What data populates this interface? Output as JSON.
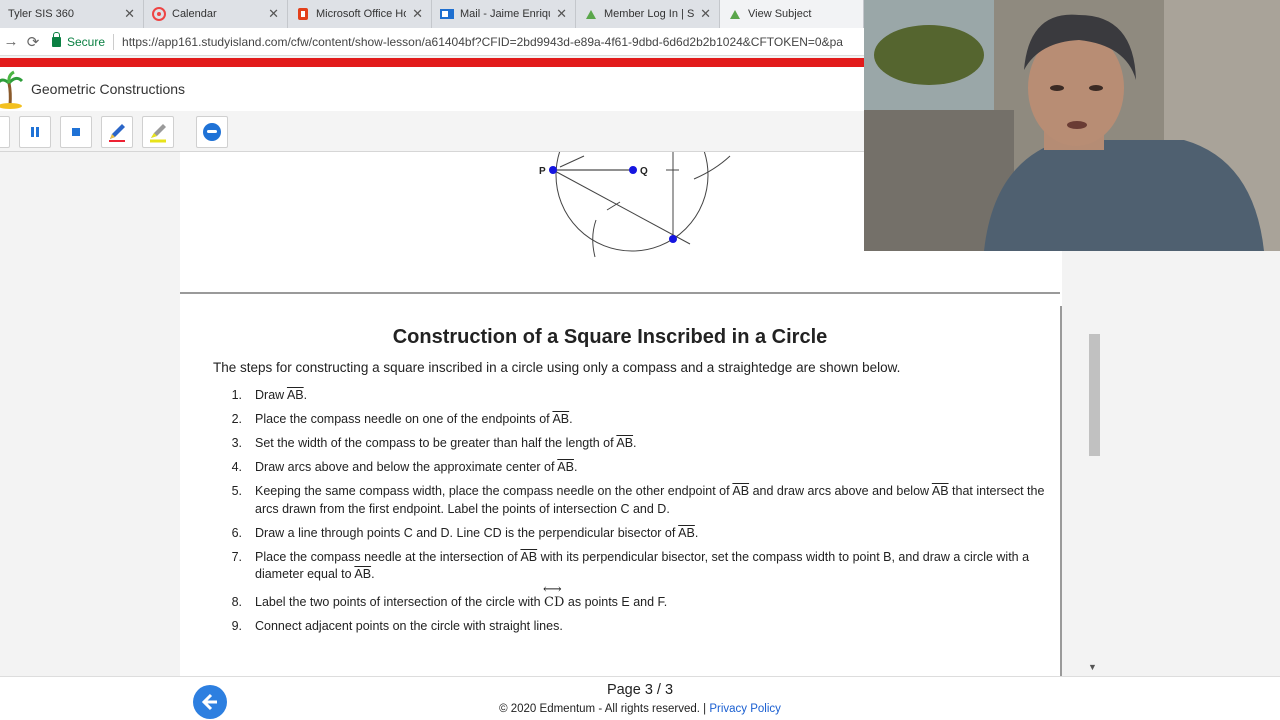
{
  "browser": {
    "tabs": [
      {
        "label": "Tyler SIS 360",
        "icon": "page-icon"
      },
      {
        "label": "Calendar",
        "icon": "calendar-icon"
      },
      {
        "label": "Microsoft Office Home",
        "icon": "office-icon"
      },
      {
        "label": "Mail - Jaime Enriquez",
        "icon": "mail-icon"
      },
      {
        "label": "Member Log In | Study",
        "icon": "study-island-icon"
      },
      {
        "label": "View Subject",
        "icon": "study-island-icon"
      }
    ],
    "secure_label": "Secure",
    "url": "https://app161.studyisland.com/cfw/content/show-lesson/a61404bf?CFID=2bd9943d-e89a-4f61-9dbd-6d6d2b2b1024&CFTOKEN=0&pa"
  },
  "app": {
    "title": "Geometric Constructions"
  },
  "diagram": {
    "point_p": "P",
    "point_q": "Q"
  },
  "lesson": {
    "title": "Construction of a Square Inscribed in a Circle",
    "intro": "The steps for constructing a square inscribed in a circle using only a compass and a straightedge are shown below.",
    "steps": [
      {
        "num": "1.",
        "parts": [
          "Draw ",
          "AB",
          "."
        ]
      },
      {
        "num": "2.",
        "parts": [
          "Place the compass needle on one of the endpoints of ",
          "AB",
          "."
        ]
      },
      {
        "num": "3.",
        "parts": [
          "Set the width of the compass to be greater than half the length of ",
          "AB",
          "."
        ]
      },
      {
        "num": "4.",
        "parts": [
          "Draw arcs above and below the approximate center of ",
          "AB",
          "."
        ]
      },
      {
        "num": "5.",
        "parts": [
          "Keeping the same compass width, place the compass needle on the other endpoint of ",
          "AB",
          " and draw arcs above and below ",
          "AB",
          " that intersect the arcs drawn from the first endpoint. Label the points of intersection C and D."
        ]
      },
      {
        "num": "6.",
        "parts": [
          "Draw a line through points C and D. Line CD is the perpendicular bisector of ",
          "AB",
          "."
        ]
      },
      {
        "num": "7.",
        "parts": [
          "Place the compass needle at the intersection of ",
          "AB",
          " with its perpendicular bisector, set the compass width to point B, and draw a circle with a diameter equal to ",
          "AB",
          "."
        ]
      },
      {
        "num": "8.",
        "parts": [
          "Label the two points of intersection of the circle with ",
          "CD",
          " as points E and F."
        ]
      },
      {
        "num": "9.",
        "parts": [
          "Connect adjacent points on the circle with straight lines."
        ]
      }
    ]
  },
  "footer": {
    "page": "Page 3 / 3",
    "copyright": "© 2020 Edmentum - All rights reserved. |",
    "privacy": "Privacy Policy"
  },
  "colors": {
    "accent_red": "#e21b1b",
    "link_blue": "#1a5fd1",
    "point_blue": "#1515e0"
  }
}
